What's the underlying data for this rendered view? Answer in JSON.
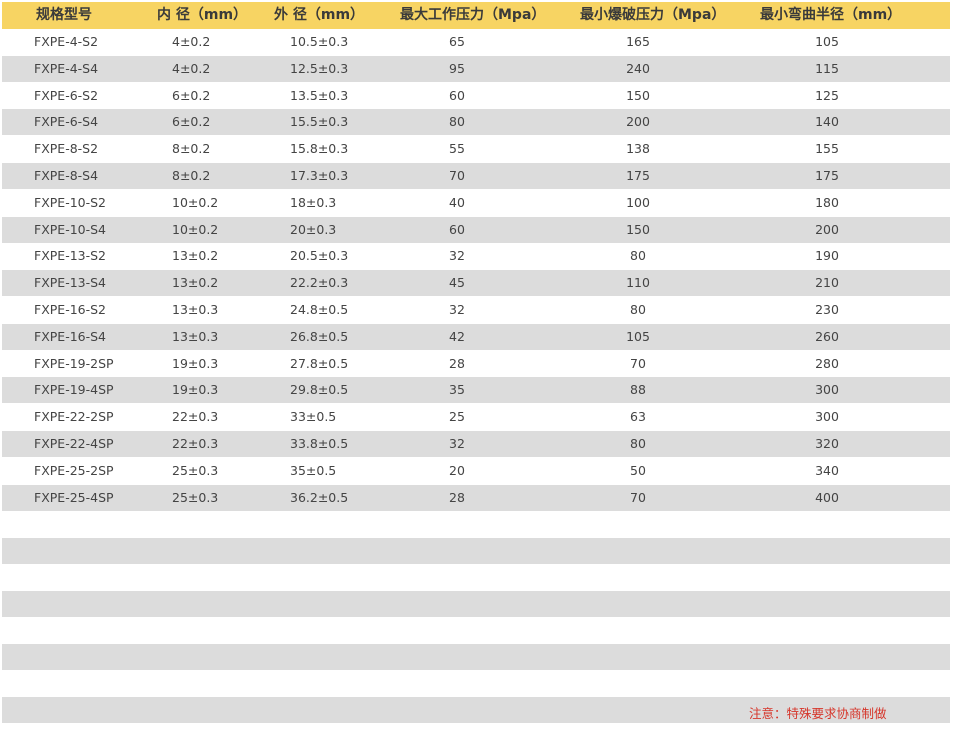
{
  "table": {
    "headers": [
      "规格型号",
      "内 径（mm）",
      "外 径（mm）",
      "最大工作压力（Mpa）",
      "最小爆破压力（Mpa）",
      "最小弯曲半径（mm）"
    ],
    "rows": [
      [
        "FXPE-4-S2",
        "4±0.2",
        "10.5±0.3",
        "65",
        "165",
        "105"
      ],
      [
        "FXPE-4-S4",
        "4±0.2",
        "12.5±0.3",
        "95",
        "240",
        "115"
      ],
      [
        "FXPE-6-S2",
        "6±0.2",
        "13.5±0.3",
        "60",
        "150",
        "125"
      ],
      [
        "FXPE-6-S4",
        "6±0.2",
        "15.5±0.3",
        "80",
        "200",
        "140"
      ],
      [
        "FXPE-8-S2",
        "8±0.2",
        "15.8±0.3",
        "55",
        "138",
        "155"
      ],
      [
        "FXPE-8-S4",
        "8±0.2",
        "17.3±0.3",
        "70",
        "175",
        "175"
      ],
      [
        "FXPE-10-S2",
        "10±0.2",
        "18±0.3",
        "40",
        "100",
        "180"
      ],
      [
        "FXPE-10-S4",
        "10±0.2",
        "20±0.3",
        "60",
        "150",
        "200"
      ],
      [
        "FXPE-13-S2",
        "13±0.2",
        "20.5±0.3",
        "32",
        "80",
        "190"
      ],
      [
        "FXPE-13-S4",
        "13±0.2",
        "22.2±0.3",
        "45",
        "110",
        "210"
      ],
      [
        "FXPE-16-S2",
        "13±0.3",
        "24.8±0.5",
        "32",
        "80",
        "230"
      ],
      [
        "FXPE-16-S4",
        "13±0.3",
        "26.8±0.5",
        "42",
        "105",
        "260"
      ],
      [
        "FXPE-19-2SP",
        "19±0.3",
        "27.8±0.5",
        "28",
        "70",
        "280"
      ],
      [
        "FXPE-19-4SP",
        "19±0.3",
        "29.8±0.5",
        "35",
        "88",
        "300"
      ],
      [
        "FXPE-22-2SP",
        "22±0.3",
        "33±0.5",
        "25",
        "63",
        "300"
      ],
      [
        "FXPE-22-4SP",
        "22±0.3",
        "33.8±0.5",
        "32",
        "80",
        "320"
      ],
      [
        "FXPE-25-2SP",
        "25±0.3",
        "35±0.5",
        "20",
        "50",
        "340"
      ],
      [
        "FXPE-25-4SP",
        "25±0.3",
        "36.2±0.5",
        "28",
        "70",
        "400"
      ]
    ]
  },
  "note": "注意：特殊要求协商制做",
  "colors": {
    "header_bg": "#f7d463",
    "stripe_bg": "#dcdcdc",
    "note_color": "#d6362b"
  }
}
